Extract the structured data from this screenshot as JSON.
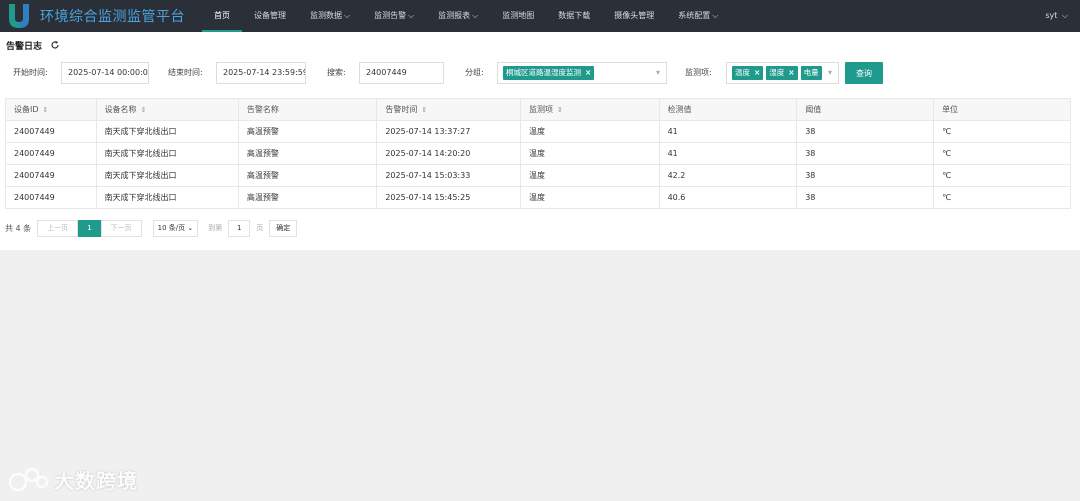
{
  "app": {
    "title": "环境综合监测监管平台",
    "user": "syt"
  },
  "nav": [
    {
      "label": "首页",
      "has_caret": false
    },
    {
      "label": "设备管理",
      "has_caret": false
    },
    {
      "label": "监测数据",
      "has_caret": true
    },
    {
      "label": "监测告警",
      "has_caret": true
    },
    {
      "label": "监测报表",
      "has_caret": true
    },
    {
      "label": "监测地图",
      "has_caret": false
    },
    {
      "label": "数据下载",
      "has_caret": false
    },
    {
      "label": "摄像头管理",
      "has_caret": false
    },
    {
      "label": "系统配置",
      "has_caret": true
    }
  ],
  "page": {
    "title": "告警日志"
  },
  "filters": {
    "start_label": "开始时间:",
    "start_value": "2025-07-14 00:00:00",
    "end_label": "结束时间:",
    "end_value": "2025-07-14 23:59:59",
    "search_label": "搜索:",
    "search_value": "24007449",
    "group_label": "分组:",
    "group_tag": "桐城区道路温湿度监测",
    "item_label": "监测项:",
    "item_tags": [
      "温度",
      "湿度",
      "电量"
    ],
    "query_button": "查询"
  },
  "table": {
    "columns": [
      "设备ID",
      "设备名称",
      "告警名称",
      "告警时间",
      "监测项",
      "检测值",
      "阈值",
      "单位"
    ],
    "rows": [
      [
        "24007449",
        "南天成下穿北线出口",
        "高温预警",
        "2025-07-14 13:37:27",
        "温度",
        "41",
        "38",
        "℃"
      ],
      [
        "24007449",
        "南天成下穿北线出口",
        "高温预警",
        "2025-07-14 14:20:20",
        "温度",
        "41",
        "38",
        "℃"
      ],
      [
        "24007449",
        "南天成下穿北线出口",
        "高温预警",
        "2025-07-14 15:03:33",
        "温度",
        "42.2",
        "38",
        "℃"
      ],
      [
        "24007449",
        "南天成下穿北线出口",
        "高温预警",
        "2025-07-14 15:45:25",
        "温度",
        "40.6",
        "38",
        "℃"
      ]
    ]
  },
  "pager": {
    "total": "共 4 条",
    "prev": "上一页",
    "current": "1",
    "next": "下一页",
    "page_size": "10 条/页",
    "goto": "到第",
    "goto_value": "1",
    "page_unit": "页",
    "confirm": "确定"
  },
  "watermark": {
    "text": "大数跨境"
  },
  "colors": {
    "topbar": "#2b3038",
    "accent": "#1f9a8c",
    "title": "#4aa3df"
  }
}
